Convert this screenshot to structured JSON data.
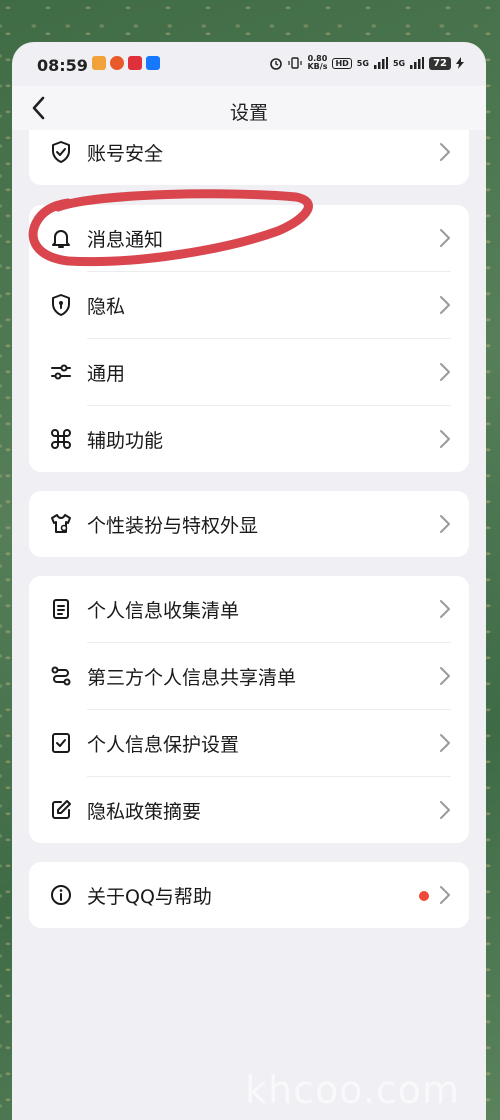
{
  "status_bar": {
    "time": "08:59",
    "speed_value": "0.80",
    "speed_unit": "KB/s",
    "hd": "HD",
    "net1": "5G",
    "net2": "5G",
    "battery": "72"
  },
  "nav": {
    "title": "设置"
  },
  "sections": {
    "account": {
      "label": "账号安全",
      "icon": "shield-check-icon"
    },
    "notify": {
      "label": "消息通知",
      "icon": "bell-icon"
    },
    "privacy": {
      "label": "隐私",
      "icon": "shield-lock-icon"
    },
    "general": {
      "label": "通用",
      "icon": "sliders-icon"
    },
    "accessibility": {
      "label": "辅助功能",
      "icon": "command-icon"
    },
    "dressup": {
      "label": "个性装扮与特权外显",
      "icon": "tshirt-icon"
    },
    "info_collect": {
      "label": "个人信息收集清单",
      "icon": "document-icon"
    },
    "third_party": {
      "label": "第三方个人信息共享清单",
      "icon": "share-icon"
    },
    "info_protect": {
      "label": "个人信息保护设置",
      "icon": "checkbox-icon"
    },
    "policy": {
      "label": "隐私政策摘要",
      "icon": "edit-icon"
    },
    "about": {
      "label": "关于QQ与帮助",
      "icon": "info-icon"
    }
  },
  "colors": {
    "accent_red": "#f04a3a",
    "annotation": "#d9464e"
  },
  "watermark": "khcoo.com"
}
